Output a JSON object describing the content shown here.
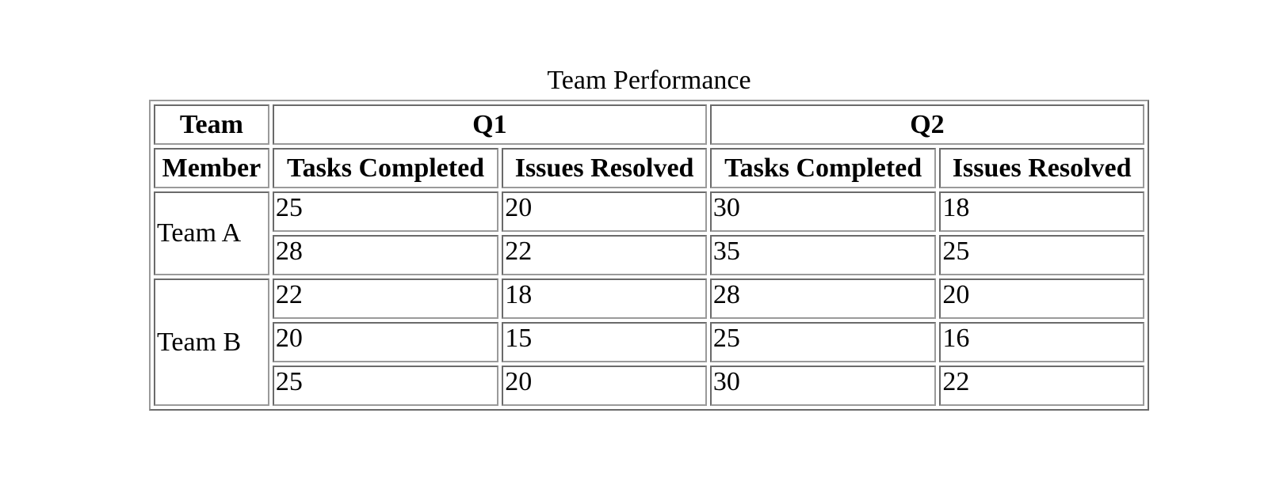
{
  "chart_data": {
    "type": "table",
    "title": "Team Performance",
    "header_row_1": [
      "Team",
      "Q1",
      "Q2"
    ],
    "header_row_2": [
      "Member",
      "Tasks Completed",
      "Issues Resolved",
      "Tasks Completed",
      "Issues Resolved"
    ],
    "groups": [
      {
        "team": "Team A",
        "rows": [
          [
            "25",
            "20",
            "30",
            "18"
          ],
          [
            "28",
            "22",
            "35",
            "25"
          ]
        ]
      },
      {
        "team": "Team B",
        "rows": [
          [
            "22",
            "18",
            "28",
            "20"
          ],
          [
            "20",
            "15",
            "25",
            "16"
          ],
          [
            "25",
            "20",
            "30",
            "22"
          ]
        ]
      }
    ]
  }
}
